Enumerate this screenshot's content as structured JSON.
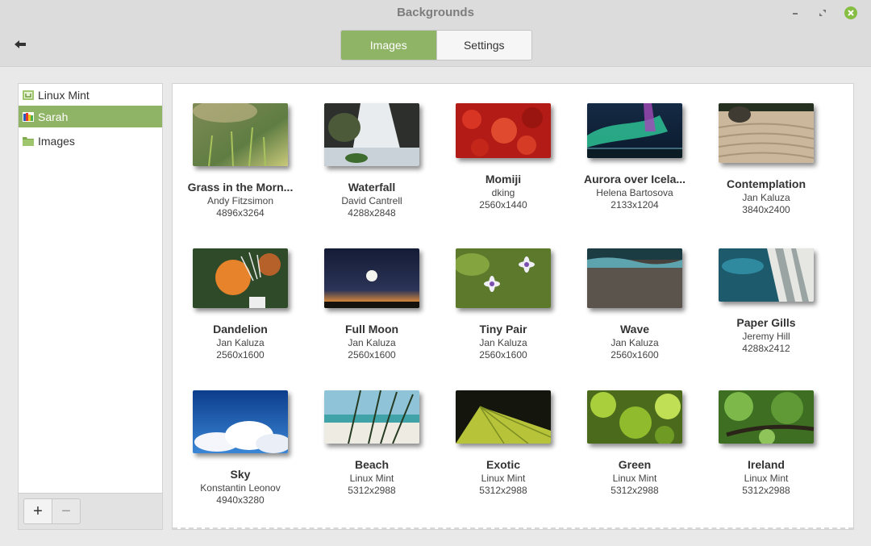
{
  "window": {
    "title": "Backgrounds"
  },
  "tabs": [
    {
      "label": "Images",
      "active": true
    },
    {
      "label": "Settings",
      "active": false
    }
  ],
  "sidebar": {
    "items": [
      {
        "label": "Linux Mint",
        "icon": "mint-folder-icon",
        "selected": false
      },
      {
        "label": "Sarah",
        "icon": "image-folder-icon",
        "selected": true
      },
      {
        "label": "Images",
        "icon": "folder-icon",
        "selected": false
      }
    ],
    "add_label": "+",
    "remove_label": "−"
  },
  "wallpapers": [
    {
      "title": "Grass in the Morn...",
      "author": "Andy Fitzsimon",
      "resolution": "4896x3264"
    },
    {
      "title": "Waterfall",
      "author": "David Cantrell",
      "resolution": "4288x2848"
    },
    {
      "title": "Momiji",
      "author": "dking",
      "resolution": "2560x1440"
    },
    {
      "title": "Aurora over Icela...",
      "author": "Helena Bartosova",
      "resolution": "2133x1204"
    },
    {
      "title": "Contemplation",
      "author": "Jan Kaluza",
      "resolution": "3840x2400"
    },
    {
      "title": "Dandelion",
      "author": "Jan Kaluza",
      "resolution": "2560x1600"
    },
    {
      "title": "Full Moon",
      "author": "Jan Kaluza",
      "resolution": "2560x1600"
    },
    {
      "title": "Tiny Pair",
      "author": "Jan Kaluza",
      "resolution": "2560x1600"
    },
    {
      "title": "Wave",
      "author": "Jan Kaluza",
      "resolution": "2560x1600"
    },
    {
      "title": "Paper Gills",
      "author": "Jeremy Hill",
      "resolution": "4288x2412"
    },
    {
      "title": "Sky",
      "author": "Konstantin Leonov",
      "resolution": "4940x3280"
    },
    {
      "title": "Beach",
      "author": "Linux Mint",
      "resolution": "5312x2988"
    },
    {
      "title": "Exotic",
      "author": "Linux Mint",
      "resolution": "5312x2988"
    },
    {
      "title": "Green",
      "author": "Linux Mint",
      "resolution": "5312x2988"
    },
    {
      "title": "Ireland",
      "author": "Linux Mint",
      "resolution": "5312x2988"
    }
  ],
  "colors": {
    "accent": "#90b466",
    "close": "#86be43"
  }
}
